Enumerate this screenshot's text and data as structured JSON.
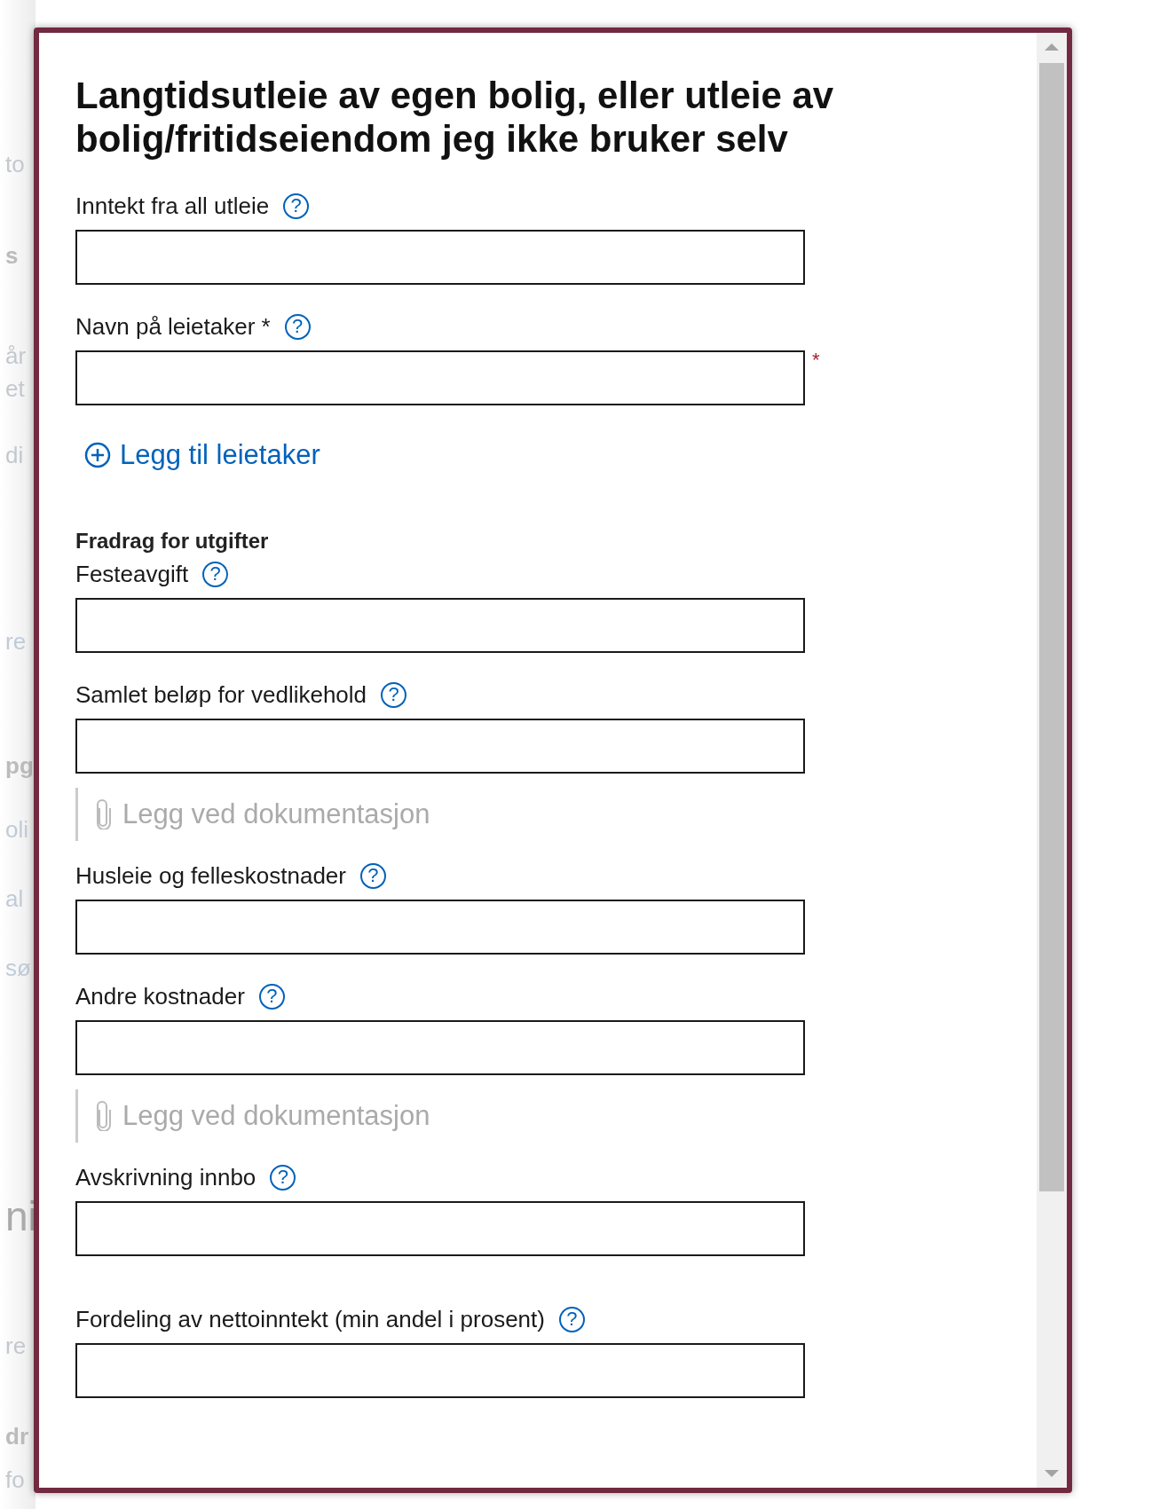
{
  "background": {
    "fragments": [
      "to",
      "s",
      "år",
      "et",
      "di",
      "re",
      "pg",
      "oli",
      "al",
      "sø",
      "ni",
      "re",
      "dr",
      "fo"
    ]
  },
  "dialog": {
    "title": "Langtidsutleie av egen bolig, eller utleie av bolig/fritidseiendom jeg ikke bruker selv",
    "items": [
      {
        "kind": "field",
        "label": "Inntekt fra all utleie",
        "help": "?"
      },
      {
        "kind": "field",
        "label": "Navn på leietaker *",
        "help": "?",
        "required_mark": "*"
      },
      {
        "kind": "add_link",
        "label": "Legg til leietaker"
      },
      {
        "kind": "heading",
        "label": "Fradrag for utgifter"
      },
      {
        "kind": "field",
        "label": "Festeavgift",
        "help": "?"
      },
      {
        "kind": "field",
        "label": "Samlet beløp for vedlikehold",
        "help": "?"
      },
      {
        "kind": "attachment",
        "label": "Legg ved dokumentasjon",
        "disabled": true
      },
      {
        "kind": "field",
        "label": "Husleie og felleskostnader",
        "help": "?"
      },
      {
        "kind": "field",
        "label": "Andre kostnader",
        "help": "?"
      },
      {
        "kind": "attachment",
        "label": "Legg ved dokumentasjon",
        "disabled": true
      },
      {
        "kind": "field",
        "label": "Avskrivning innbo",
        "help": "?"
      },
      {
        "kind": "field",
        "label": "Fordeling av nettoinntekt (min andel i prosent)",
        "help": "?"
      }
    ]
  }
}
